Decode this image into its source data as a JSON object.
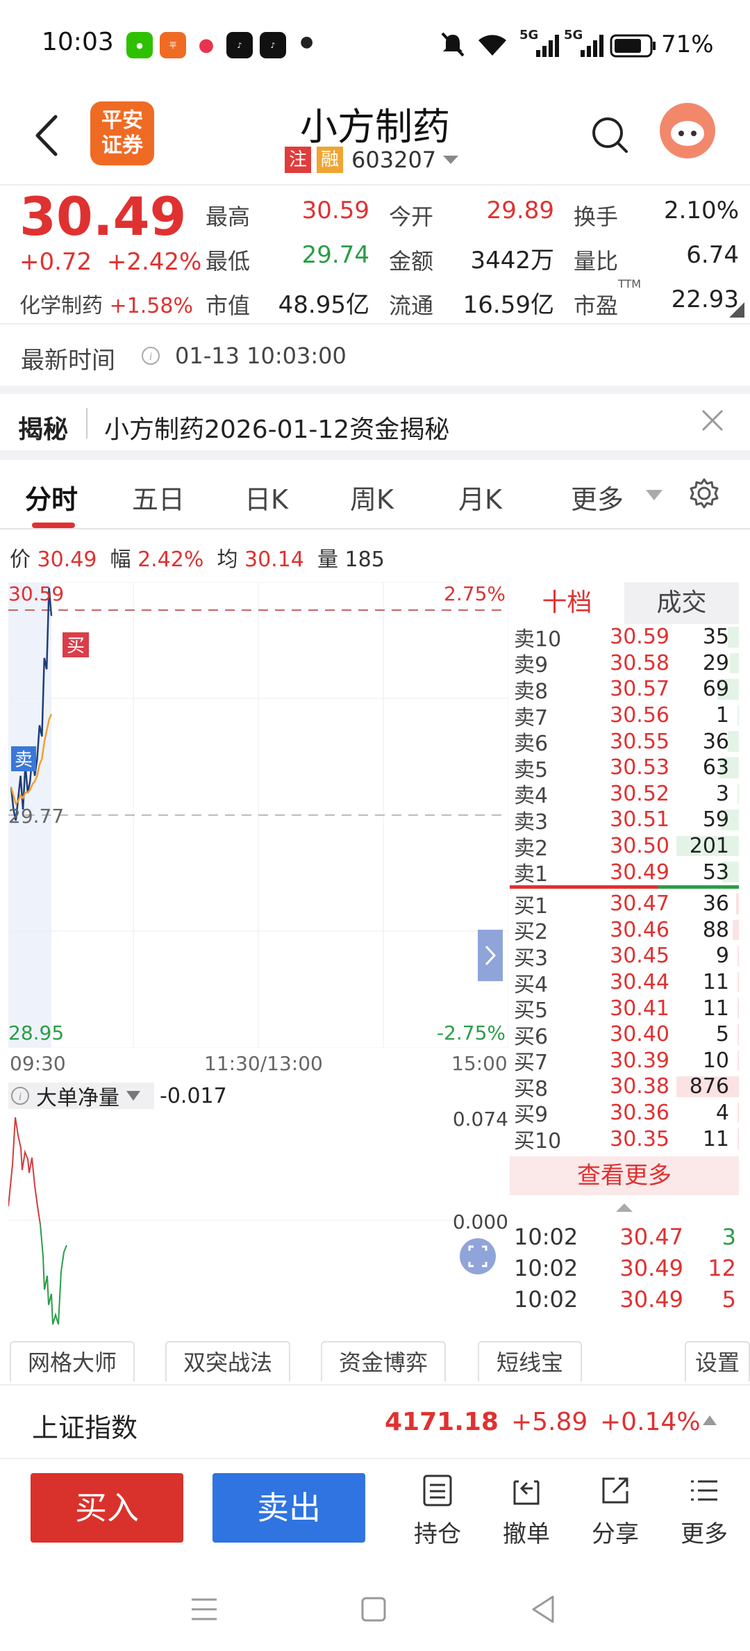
{
  "status_bar": {
    "time": "10:03",
    "battery": "71%",
    "signal1": "5G",
    "signal2": "5G"
  },
  "header": {
    "title": "小方制药",
    "tag1": "注",
    "tag2": "融",
    "code": "603207",
    "logo_line1": "平安",
    "logo_line2": "证券"
  },
  "quote": {
    "price": "30.49",
    "change": "+0.72",
    "change_pct": "+2.42%",
    "sector_name": "化学制药",
    "sector_pct": "+1.58%",
    "stats": [
      {
        "label": "最高",
        "value": "30.59",
        "color": "red"
      },
      {
        "label": "今开",
        "value": "29.89",
        "color": "red"
      },
      {
        "label": "换手",
        "value": "2.10%",
        "color": "black"
      },
      {
        "label": "最低",
        "value": "29.74",
        "color": "green"
      },
      {
        "label": "金额",
        "value": "3442万",
        "color": "black"
      },
      {
        "label": "量比",
        "value": "6.74",
        "color": "black"
      },
      {
        "label": "市值",
        "value": "48.95亿",
        "color": "black"
      },
      {
        "label": "流通",
        "value": "16.59亿",
        "color": "black"
      },
      {
        "label": "市盈",
        "value": "22.93",
        "color": "black"
      }
    ],
    "pe_sup": "TTM"
  },
  "update_time": {
    "label": "最新时间",
    "value": "01-13 10:03:00"
  },
  "reveal": {
    "label": "揭秘",
    "text": "小方制药2026-01-12资金揭秘"
  },
  "tabs": [
    "分时",
    "五日",
    "日K",
    "周K",
    "月K",
    "更多"
  ],
  "info_line": {
    "price_label": "价",
    "price": "30.49",
    "range_label": "幅",
    "range": "2.42%",
    "avg_label": "均",
    "avg": "30.14",
    "vol_label": "量",
    "vol": "185"
  },
  "chart_axis": {
    "y_top": "30.59",
    "y_mid": "29.77",
    "y_bottom": "28.95",
    "pct_top": "2.75%",
    "pct_bottom": "-2.75%",
    "buy_mark": "买",
    "sell_mark": "卖"
  },
  "time_axis": [
    "09:30",
    "11:30/13:00",
    "15:00"
  ],
  "chart_data": {
    "type": "line",
    "title": "",
    "xlabel": "",
    "ylabel": "",
    "ylim": [
      28.95,
      30.59
    ],
    "series": [
      {
        "values": [
          29.88,
          29.8,
          29.76,
          29.84,
          29.92,
          29.8,
          29.96,
          29.86,
          29.9,
          30.0,
          29.92,
          29.98,
          30.1,
          30.06,
          30.34,
          30.3,
          30.59,
          30.49
        ]
      },
      {
        "values": [
          29.88,
          29.85,
          29.82,
          29.83,
          29.85,
          29.84,
          29.86,
          29.86,
          29.87,
          29.89,
          29.9,
          29.92,
          29.96,
          29.98,
          30.04,
          30.08,
          30.12,
          30.14
        ]
      }
    ]
  },
  "order_book": {
    "tab_active": "十档",
    "tab_other": "成交",
    "asks": [
      {
        "label": "卖10",
        "price": "30.59",
        "vol": "35"
      },
      {
        "label": "卖9",
        "price": "30.58",
        "vol": "29"
      },
      {
        "label": "卖8",
        "price": "30.57",
        "vol": "69"
      },
      {
        "label": "卖7",
        "price": "30.56",
        "vol": "1"
      },
      {
        "label": "卖6",
        "price": "30.55",
        "vol": "36"
      },
      {
        "label": "卖5",
        "price": "30.53",
        "vol": "63"
      },
      {
        "label": "卖4",
        "price": "30.52",
        "vol": "3"
      },
      {
        "label": "卖3",
        "price": "30.51",
        "vol": "59"
      },
      {
        "label": "卖2",
        "price": "30.50",
        "vol": "201"
      },
      {
        "label": "卖1",
        "price": "30.49",
        "vol": "53"
      }
    ],
    "bids": [
      {
        "label": "买1",
        "price": "30.47",
        "vol": "36"
      },
      {
        "label": "买2",
        "price": "30.46",
        "vol": "88"
      },
      {
        "label": "买3",
        "price": "30.45",
        "vol": "9"
      },
      {
        "label": "买4",
        "price": "30.44",
        "vol": "11"
      },
      {
        "label": "买5",
        "price": "30.41",
        "vol": "11"
      },
      {
        "label": "买6",
        "price": "30.40",
        "vol": "5"
      },
      {
        "label": "买7",
        "price": "30.39",
        "vol": "10"
      },
      {
        "label": "买8",
        "price": "30.38",
        "vol": "876"
      },
      {
        "label": "买9",
        "price": "30.36",
        "vol": "4"
      },
      {
        "label": "买10",
        "price": "30.35",
        "vol": "11"
      }
    ],
    "more_label": "查看更多",
    "trades": [
      {
        "time": "10:02",
        "price": "30.47",
        "vol": "3",
        "color": "green"
      },
      {
        "time": "10:02",
        "price": "30.49",
        "vol": "12",
        "color": "red"
      },
      {
        "time": "10:02",
        "price": "30.49",
        "vol": "5",
        "color": "red"
      }
    ]
  },
  "net_flow": {
    "label": "大单净量",
    "value": "-0.017",
    "axis_top": "0.074",
    "axis_zero": "0.000"
  },
  "tools": [
    "网格大师",
    "双突战法",
    "资金博弈",
    "短线宝",
    "设置"
  ],
  "index_bar": {
    "name": "上证指数",
    "value": "4171.18",
    "change": "+5.89",
    "pct": "+0.14%"
  },
  "actions": {
    "buy": "买入",
    "sell": "卖出",
    "items": [
      "持仓",
      "撤单",
      "分享",
      "更多"
    ]
  }
}
